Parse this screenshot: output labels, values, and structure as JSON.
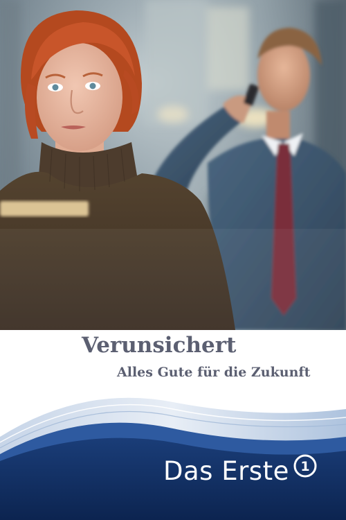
{
  "poster": {
    "title": "Verunsichert",
    "subtitle": "Alles Gute für die Zukunft",
    "broadcaster": "Das Erste",
    "broadcaster_mark": "1"
  },
  "colors": {
    "title_text": "#5b5f71",
    "band_navy": "#0f2a5a",
    "hair_red": "#c8552a",
    "sweater": "#4a3a2c",
    "shirt_blue": "#3e5670",
    "tie": "#7a2e3a"
  },
  "icons": {
    "logo_mark": "das-erste-one-icon"
  }
}
